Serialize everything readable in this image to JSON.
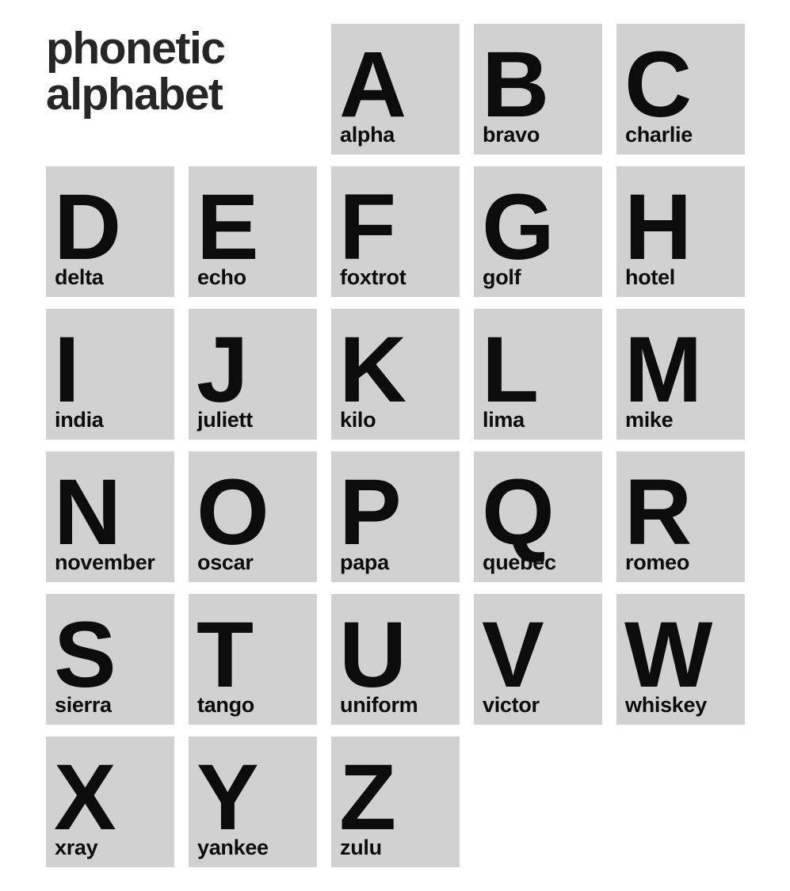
{
  "title": {
    "line1": "phonetic",
    "line2": "alphabet",
    "full": "phonetic\nalphabet"
  },
  "colors": {
    "cell_background": "#d1d1d1",
    "page_background": "#ffffff",
    "letter": "#0c0c0c",
    "title": "#262626"
  },
  "entries": [
    {
      "letter": "A",
      "word": "alpha"
    },
    {
      "letter": "B",
      "word": "bravo"
    },
    {
      "letter": "C",
      "word": "charlie"
    },
    {
      "letter": "D",
      "word": "delta"
    },
    {
      "letter": "E",
      "word": "echo"
    },
    {
      "letter": "F",
      "word": "foxtrot"
    },
    {
      "letter": "G",
      "word": "golf"
    },
    {
      "letter": "H",
      "word": "hotel"
    },
    {
      "letter": "I",
      "word": "india"
    },
    {
      "letter": "J",
      "word": "juliett"
    },
    {
      "letter": "K",
      "word": "kilo"
    },
    {
      "letter": "L",
      "word": "lima"
    },
    {
      "letter": "M",
      "word": "mike"
    },
    {
      "letter": "N",
      "word": "november"
    },
    {
      "letter": "O",
      "word": "oscar"
    },
    {
      "letter": "P",
      "word": "papa"
    },
    {
      "letter": "Q",
      "word": "quebec"
    },
    {
      "letter": "R",
      "word": "romeo"
    },
    {
      "letter": "S",
      "word": "sierra"
    },
    {
      "letter": "T",
      "word": "tango"
    },
    {
      "letter": "U",
      "word": "uniform"
    },
    {
      "letter": "V",
      "word": "victor"
    },
    {
      "letter": "W",
      "word": "whiskey"
    },
    {
      "letter": "X",
      "word": "xray"
    },
    {
      "letter": "Y",
      "word": "yankee"
    },
    {
      "letter": "Z",
      "word": "zulu"
    }
  ]
}
